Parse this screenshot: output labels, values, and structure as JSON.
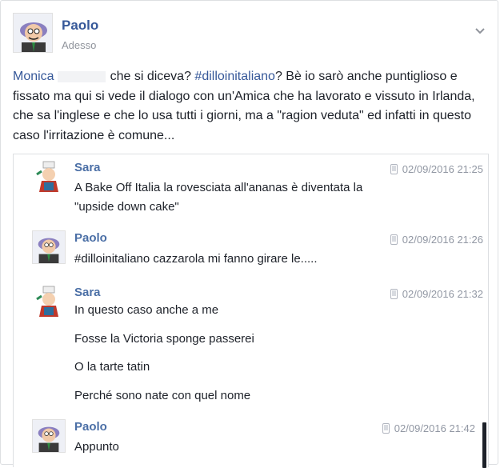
{
  "post": {
    "author": "Paolo",
    "timestamp": "Adesso",
    "mention": "Monica",
    "text_part1": "che si diceva?",
    "hashtag": "#dilloinitaliano",
    "text_part2": "? Bè io sarò anche puntiglioso e fissato ma qui si vede il dialogo con un'Amica che ha lavorato e vissuto in Irlanda, che sa l'inglese e che lo usa tutti i giorni, ma a \"ragion veduta\" ed infatti in questo caso l'irritazione è comune..."
  },
  "conversation": [
    {
      "sender": "Sara",
      "avatar": "sara-cartoon-avatar",
      "datetime": "02/09/2016 21:25",
      "lines": [
        "A Bake Off Italia la rovesciata all'ananas è diventata la",
        "\"upside down cake\""
      ]
    },
    {
      "sender": "Paolo",
      "avatar": "paolo-cartoon-avatar",
      "datetime": "02/09/2016 21:26",
      "lines": [
        "#dilloinitaliano cazzarola mi fanno girare le....."
      ]
    },
    {
      "sender": "Sara",
      "avatar": "sara-cartoon-avatar",
      "datetime": "02/09/2016 21:32",
      "lines": [
        "In questo caso anche a me",
        "Fosse la Victoria sponge passerei",
        "O la tarte tatin",
        "Perché sono nate con quel nome"
      ]
    },
    {
      "sender": "Paolo",
      "avatar": "paolo-cartoon-avatar",
      "datetime": "02/09/2016 21:42",
      "lines": [
        "Appunto"
      ]
    }
  ],
  "icons": {
    "options": "chevron-down-icon",
    "device": "mobile-phone-icon"
  },
  "colors": {
    "link": "#365899",
    "sender": "#4b6fa6",
    "meta": "#9197a3",
    "text": "#1d2129"
  }
}
